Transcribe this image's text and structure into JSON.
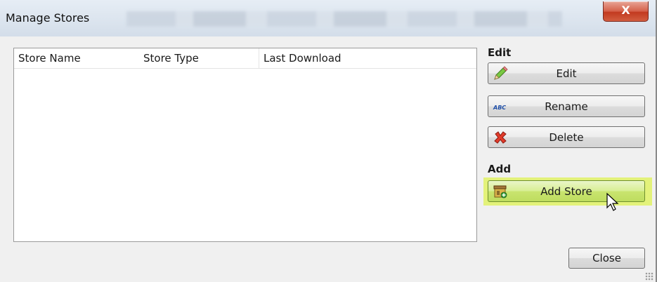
{
  "window": {
    "title": "Manage Stores",
    "close_glyph": "X"
  },
  "list": {
    "columns": [
      "Store Name",
      "Store Type",
      "Last Download"
    ],
    "rows": []
  },
  "groups": {
    "edit": {
      "label": "Edit",
      "buttons": [
        {
          "label": "Edit",
          "icon": "pencil-icon"
        },
        {
          "label": "Rename",
          "icon": "abc-icon"
        },
        {
          "label": "Delete",
          "icon": "red-x-icon"
        }
      ]
    },
    "add": {
      "label": "Add",
      "buttons": [
        {
          "label": "Add Store",
          "icon": "add-store-icon",
          "highlighted": true
        }
      ]
    }
  },
  "footer": {
    "close_label": "Close"
  },
  "colors": {
    "highlight": "#e3f27a",
    "close_red": "#c23a20"
  }
}
